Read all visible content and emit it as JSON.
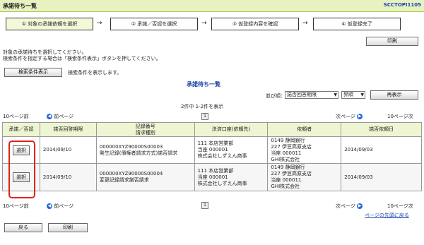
{
  "window": {
    "title": "承諾待ち一覧",
    "screen_id": "SCCTOPI1105"
  },
  "steps": [
    {
      "label": "① 対象の承諾依頼を選択",
      "active": true
    },
    {
      "label": "② 承諾／否認を選択",
      "active": false
    },
    {
      "label": "③ 仮登録内容を確認",
      "active": false
    },
    {
      "label": "④ 仮登録完了",
      "active": false
    }
  ],
  "step_arrow": "→",
  "toolbar": {
    "print_label": "印刷"
  },
  "instructions": {
    "line1": "対象の承諾待ちを選択してください。",
    "line2": "検索条件を指定する場合は「検索条件表示」ボタンを押してください。"
  },
  "search": {
    "show_button": "検索条件表示",
    "hint": "検索条件を表示します。"
  },
  "list": {
    "heading": "承諾待ち一覧",
    "sort_label": "並び順：",
    "sort_value": "諾否回答期限",
    "order_value": "昇順",
    "resort_button": "再表示",
    "count_text": "2件中 1-2件を表示"
  },
  "pagination": {
    "prev10": "10ページ前",
    "prev": "前ページ",
    "current": "1",
    "next": "次ページ",
    "next10": "10ページ次"
  },
  "table": {
    "headers": {
      "select": "承諾／否認",
      "deadline": "諾否回答期限",
      "record": "記録番号\n請求種別",
      "account": "決済口座(依頼先)",
      "requester": "依頼者",
      "request_date": "諾否依頼日"
    },
    "rows": [
      {
        "select_label": "選択",
        "deadline": "2014/09/10",
        "record_no": "000000XYZ90000S00003",
        "record_type": "発生記録(債権者請求方式)諾否請求",
        "account": [
          "111 本店営業部",
          "当座 000001",
          "株式会社しずえん商事"
        ],
        "requester": [
          "0149 静岡銀行",
          "227 伊豆高原支店",
          "当座 000011",
          "GHI株式会社"
        ],
        "request_date": "2014/09/03"
      },
      {
        "select_label": "選択",
        "deadline": "2014/09/10",
        "record_no": "000000XYZ90000S00004",
        "record_type": "変更記録請求諾否請求",
        "account": [
          "111 本店営業部",
          "当座 000001",
          "株式会社しずえん商事"
        ],
        "requester": [
          "0149 静岡銀行",
          "227 伊豆高原支店",
          "当座 000011",
          "GHI株式会社"
        ],
        "request_date": "2014/09/03"
      }
    ]
  },
  "footer": {
    "back_button": "戻る",
    "print_button": "印刷",
    "top_link": "ページの先頭に戻る"
  },
  "colors": {
    "title_bg": "#e6f2c0",
    "accent_blue": "#1a44a8",
    "highlight_red": "#e0221a"
  }
}
